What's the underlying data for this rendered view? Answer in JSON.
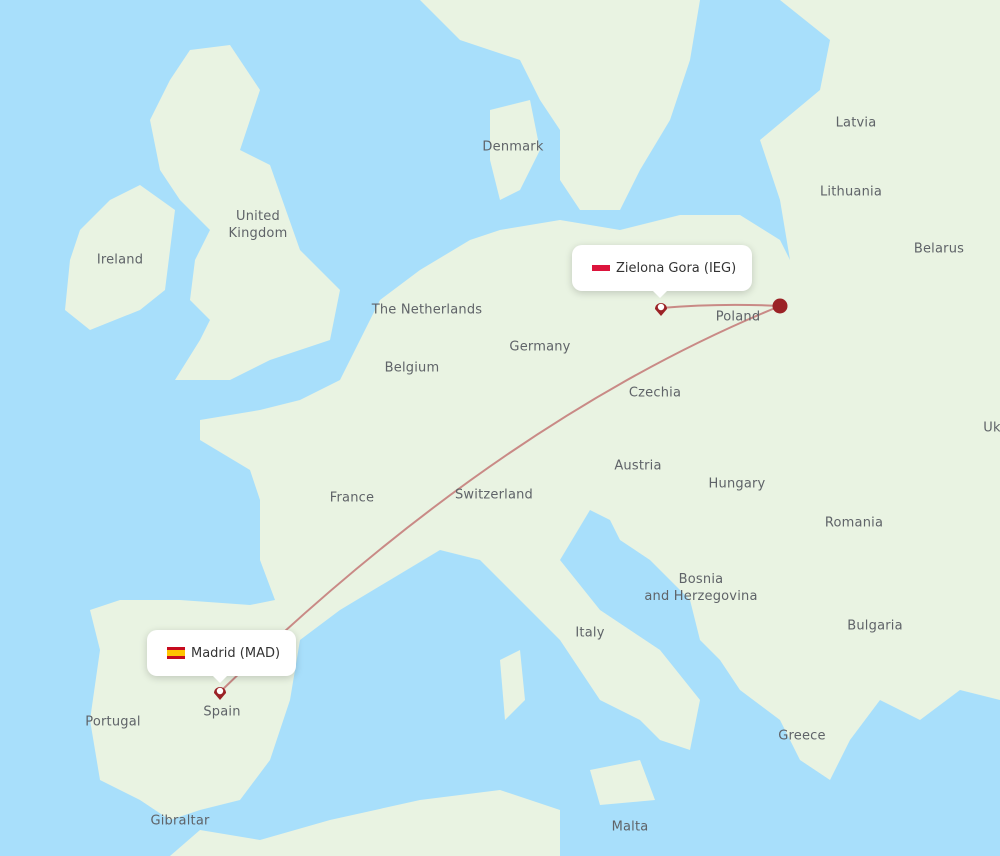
{
  "map": {
    "colors": {
      "water": "#a8dffb",
      "land": "#e9f3e2",
      "border": "#8fce8a",
      "route": "#c98a86",
      "marker": "#9b2226"
    },
    "country_labels": [
      {
        "name": "Ireland"
      },
      {
        "name": "United\nKingdom"
      },
      {
        "name": "Denmark"
      },
      {
        "name": "Latvia"
      },
      {
        "name": "Lithuania"
      },
      {
        "name": "Belarus"
      },
      {
        "name": "The Netherlands"
      },
      {
        "name": "Belgium"
      },
      {
        "name": "Germany"
      },
      {
        "name": "Poland"
      },
      {
        "name": "Czechia"
      },
      {
        "name": "Uk"
      },
      {
        "name": "France"
      },
      {
        "name": "Switzerland"
      },
      {
        "name": "Austria"
      },
      {
        "name": "Hungary"
      },
      {
        "name": "Romania"
      },
      {
        "name": "Bosnia\nand Herzegovina"
      },
      {
        "name": "Italy"
      },
      {
        "name": "Bulgaria"
      },
      {
        "name": "Portugal"
      },
      {
        "name": "Spain"
      },
      {
        "name": "Greece"
      },
      {
        "name": "Gibraltar"
      },
      {
        "name": "Malta"
      }
    ],
    "airports": [
      {
        "city": "Zielona Gora",
        "code": "IEG",
        "label": "Zielona Gora (IEG)",
        "flag": "poland-flag"
      },
      {
        "city": "Madrid",
        "code": "MAD",
        "label": "Madrid (MAD)",
        "flag": "spain-flag"
      }
    ]
  }
}
